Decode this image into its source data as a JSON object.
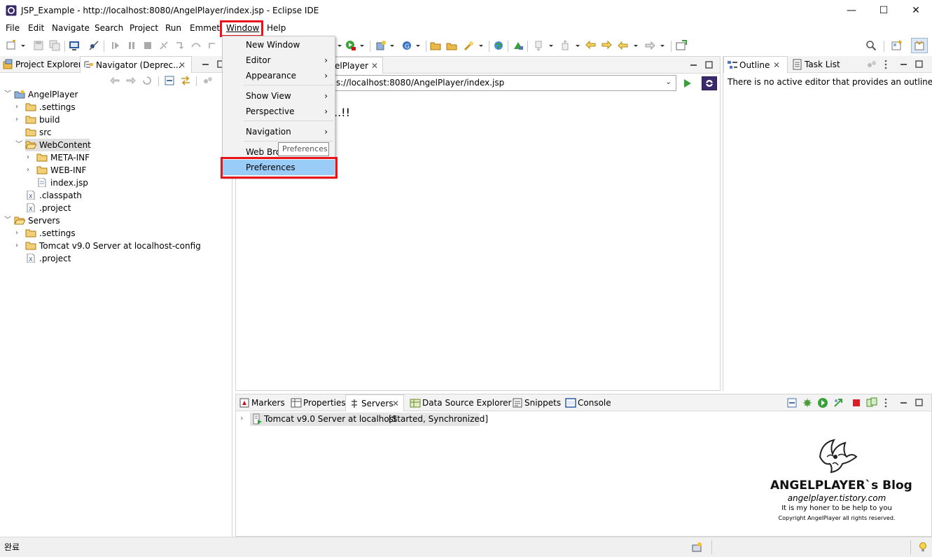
{
  "window": {
    "title": "JSP_Example - http://localhost:8080/AngelPlayer/index.jsp - Eclipse IDE",
    "minimize": "—",
    "maximize": "☐",
    "close": "✕"
  },
  "menubar": {
    "items": [
      "File",
      "Edit",
      "Navigate",
      "Search",
      "Project",
      "Run",
      "Emmet",
      "Window",
      "Help"
    ]
  },
  "window_menu": {
    "items": [
      {
        "label": "New Window",
        "submenu": false
      },
      {
        "label": "Editor",
        "submenu": true
      },
      {
        "label": "Appearance",
        "submenu": true
      },
      {
        "label": "Show View",
        "submenu": true
      },
      {
        "label": "Perspective",
        "submenu": true
      },
      {
        "label": "Navigation",
        "submenu": true
      },
      {
        "label": "Web Bro",
        "submenu": false
      },
      {
        "label": "Preferences",
        "submenu": false,
        "highlighted": true
      }
    ],
    "tooltip": "Preferences",
    "highlight_color": "#99ccf6",
    "annotation_color": "#e8141c"
  },
  "left_view": {
    "tabs": [
      "Project Explorer",
      "Navigator (Deprec..."
    ],
    "tree": [
      {
        "label": "AngelPlayer",
        "kind": "project"
      },
      {
        "label": ".settings",
        "kind": "folder"
      },
      {
        "label": "build",
        "kind": "folder"
      },
      {
        "label": "src",
        "kind": "folder"
      },
      {
        "label": "WebContent",
        "kind": "folder-open",
        "selected": true
      },
      {
        "label": "META-INF",
        "kind": "folder"
      },
      {
        "label": "WEB-INF",
        "kind": "folder"
      },
      {
        "label": "index.jsp",
        "kind": "file"
      },
      {
        "label": ".classpath",
        "kind": "xfile"
      },
      {
        "label": ".project",
        "kind": "xfile"
      },
      {
        "label": "Servers",
        "kind": "folder-open"
      },
      {
        "label": ".settings",
        "kind": "folder"
      },
      {
        "label": "Tomcat v9.0 Server at localhost-config",
        "kind": "folder"
      },
      {
        "label": ".project",
        "kind": "xfile"
      }
    ]
  },
  "editor": {
    "tab_label": "elPlayer",
    "url": "s://localhost:8080/AngelPlayer/index.jsp",
    "content": "..!!"
  },
  "outline": {
    "tabs": [
      "Outline",
      "Task List"
    ],
    "message": "There is no active editor that provides an outline."
  },
  "bottom_view": {
    "tabs": [
      "Markers",
      "Properties",
      "Servers",
      "Data Source Explorer",
      "Snippets",
      "Console"
    ],
    "server_row": "Tomcat v9.0 Server at localhost",
    "server_status": "[Started, Synchronized]"
  },
  "status": {
    "text": "완료"
  },
  "watermark": {
    "title": "ANGELPLAYER`s Blog",
    "url": "angelplayer.tistory.com",
    "tagline": "It is my honer to be help to you",
    "copyright": "Copyright AngelPlayer all rights reserved."
  }
}
